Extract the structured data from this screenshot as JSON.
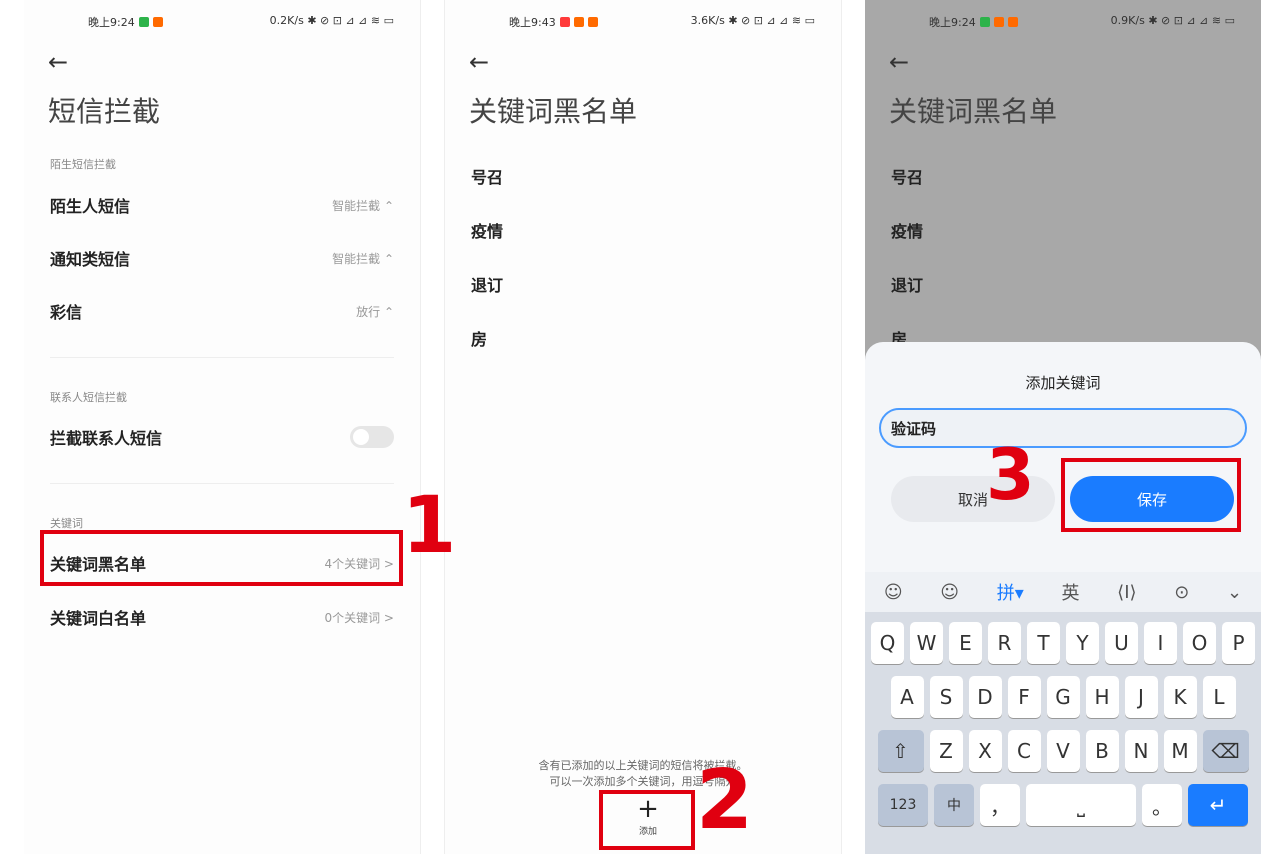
{
  "panel1": {
    "status_left": "晚上9:24",
    "status_right": "0.2K/s ✱ ⊘ ⊡ ⊿ ⊿ ≋ ▭",
    "back": "←",
    "title": "短信拦截",
    "section1": "陌生短信拦截",
    "rows": [
      {
        "label": "陌生人短信",
        "value": "智能拦截 ⌃"
      },
      {
        "label": "通知类短信",
        "value": "智能拦截 ⌃"
      },
      {
        "label": "彩信",
        "value": "放行 ⌃"
      }
    ],
    "section2": "联系人短信拦截",
    "contact_row": "拦截联系人短信",
    "section3": "关键词",
    "blacklist": {
      "label": "关键词黑名单",
      "value": "4个关键词 >"
    },
    "whitelist": {
      "label": "关键词白名单",
      "value": "0个关键词 >"
    }
  },
  "panel2": {
    "status_left": "晚上9:43",
    "status_right": "3.6K/s ✱ ⊘ ⊡ ⊿ ⊿ ≋ ▭",
    "back": "←",
    "title": "关键词黑名单",
    "keywords": [
      "号召",
      "疫情",
      "退订",
      "房"
    ],
    "hint_line1": "含有已添加的以上关键词的短信将被拦截。",
    "hint_line2": "可以一次添加多个关键词，用逗号隔开",
    "add_symbol": "+",
    "add_label": "添加"
  },
  "panel3": {
    "status_left": "晚上9:24",
    "status_right": "0.9K/s ✱ ⊘ ⊡ ⊿ ⊿ ≋ ▭",
    "back": "←",
    "title": "关键词黑名单",
    "keywords": [
      "号召",
      "疫情",
      "退订",
      "房"
    ],
    "dialog_title": "添加关键词",
    "input_value": "验证码",
    "cancel": "取消",
    "save": "保存",
    "toolbar": [
      "☺",
      "☺",
      "拼▾",
      "英",
      "⟨I⟩",
      "⊙",
      "⌄"
    ],
    "row1": [
      "Q",
      "W",
      "E",
      "R",
      "T",
      "Y",
      "U",
      "I",
      "O",
      "P"
    ],
    "row2": [
      "A",
      "S",
      "D",
      "F",
      "G",
      "H",
      "J",
      "K",
      "L"
    ],
    "row3": [
      "Z",
      "X",
      "C",
      "V",
      "B",
      "N",
      "M"
    ],
    "shift": "⇧",
    "backspace": "⌫",
    "num": "123",
    "cn": "中",
    "comma": "，",
    "space": "⎵",
    "period": "。",
    "enter": "↵"
  },
  "annotations": {
    "one": "1",
    "two": "2",
    "three": "3"
  },
  "colors": {
    "accent": "#1a7cff",
    "annotation": "#e00010"
  }
}
